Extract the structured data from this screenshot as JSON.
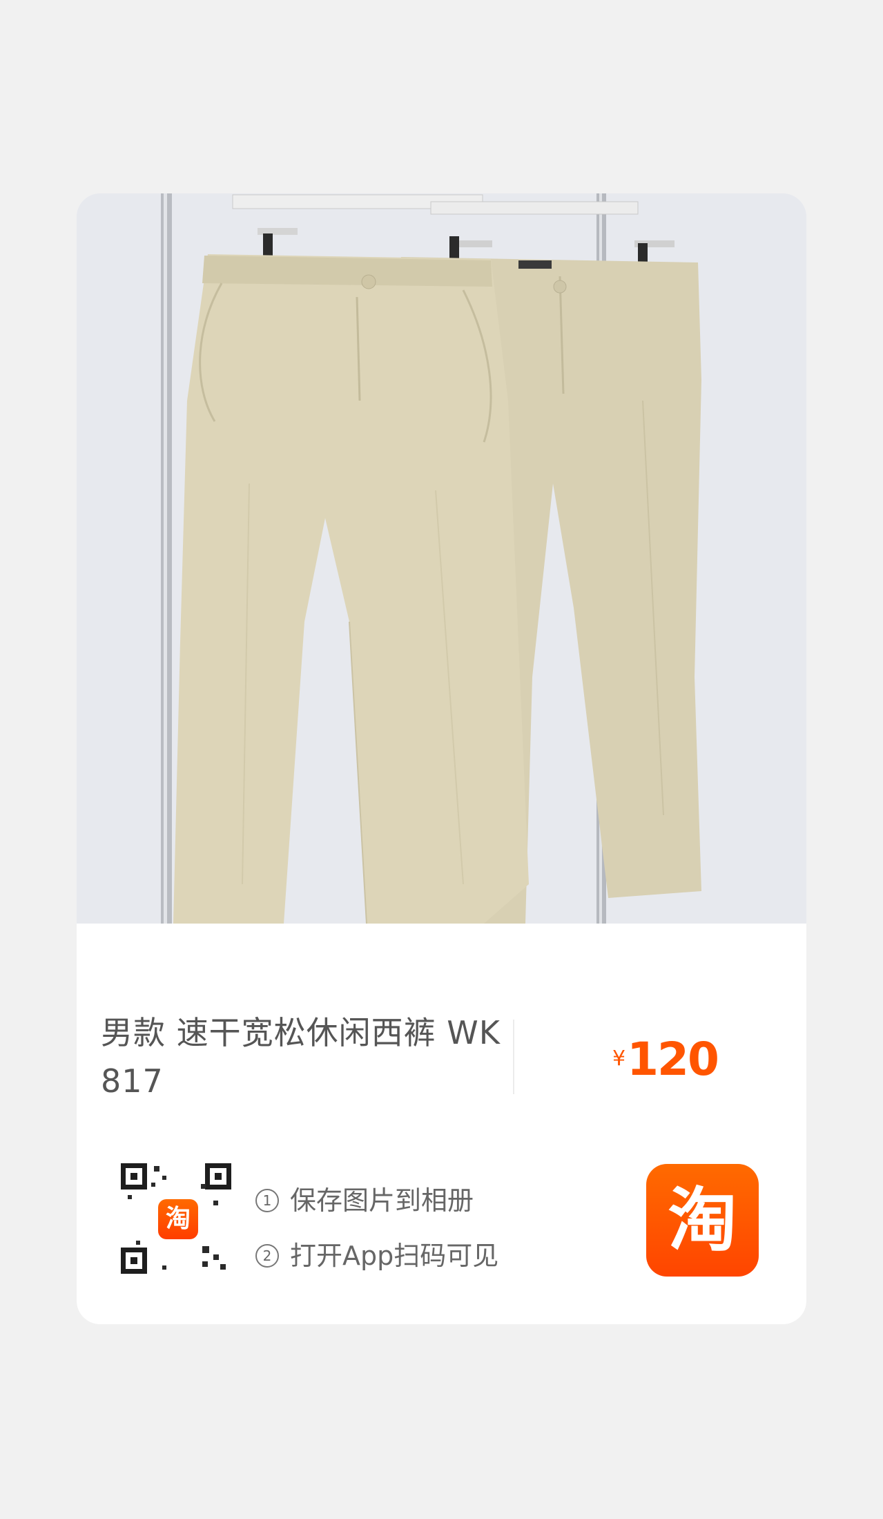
{
  "product": {
    "title": "男款 速干宽松休闲西裤 WK817",
    "price_symbol": "¥",
    "price_value": "120",
    "image_subject": "beige trousers on hangers"
  },
  "qr": {
    "logo_text": "淘"
  },
  "steps": [
    {
      "num": "1",
      "text": "保存图片到相册"
    },
    {
      "num": "2",
      "text": "打开App扫码可见"
    }
  ],
  "app": {
    "icon_text": "淘",
    "icon_color": "#ff5500"
  },
  "colors": {
    "price": "#ff5500",
    "background": "#f1f1f1",
    "card": "#ffffff"
  }
}
